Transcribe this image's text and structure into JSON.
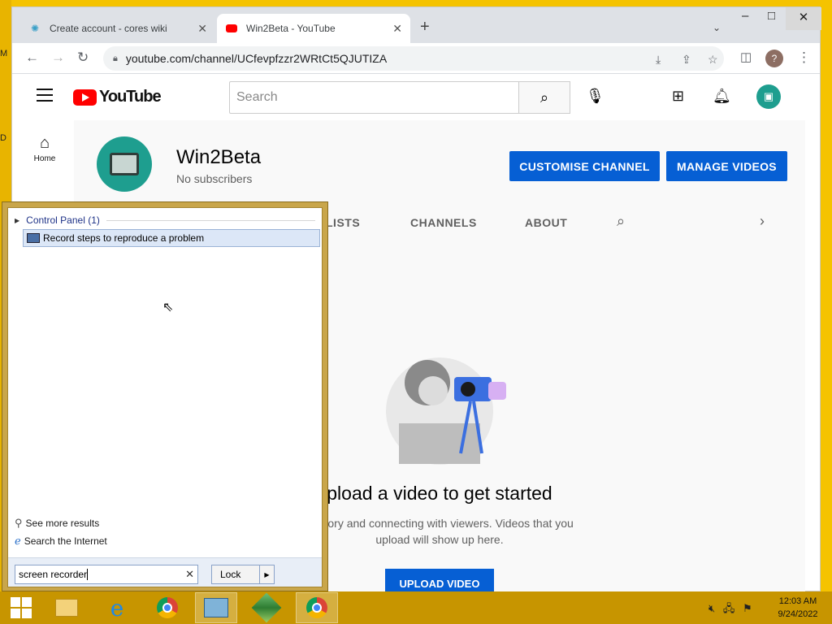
{
  "desktop": {
    "left_fragment_1": "M",
    "left_fragment_2": "D"
  },
  "browser": {
    "tabs": [
      {
        "title": "Create account - cores wiki"
      },
      {
        "title": "Win2Beta - YouTube"
      }
    ],
    "url": "youtube.com/channel/UCfevpfzzr2WRtCt5QJUTIZA",
    "profile_initial": "?"
  },
  "youtube": {
    "logo_text": "YouTube",
    "search_placeholder": "Search",
    "sidebar": {
      "home_label": "Home"
    },
    "channel": {
      "name": "Win2Beta",
      "subscribers": "No subscribers",
      "customise_label": "CUSTOMISE CHANNEL",
      "manage_label": "MANAGE VIDEOS"
    },
    "channel_tabs": {
      "playlists_partial": "LISTS",
      "channels": "CHANNELS",
      "about": "ABOUT"
    },
    "empty_state": {
      "title": "pload a video to get started",
      "description": "ur story and connecting with viewers. Videos that you upload will show up here.",
      "upload_label": "UPLOAD VIDEO"
    }
  },
  "start_search": {
    "group_label": "Control Panel (1)",
    "result_label": "Record steps to reproduce a problem",
    "see_more": "See more results",
    "search_internet": "Search the Internet",
    "query": "screen recorder",
    "lock_label": "Lock"
  },
  "taskbar": {
    "time": "12:03 AM",
    "date": "9/24/2022"
  },
  "colors": {
    "accent_blue": "#065fd4",
    "youtube_red": "#ff0000",
    "desktop": "#f5c300"
  }
}
